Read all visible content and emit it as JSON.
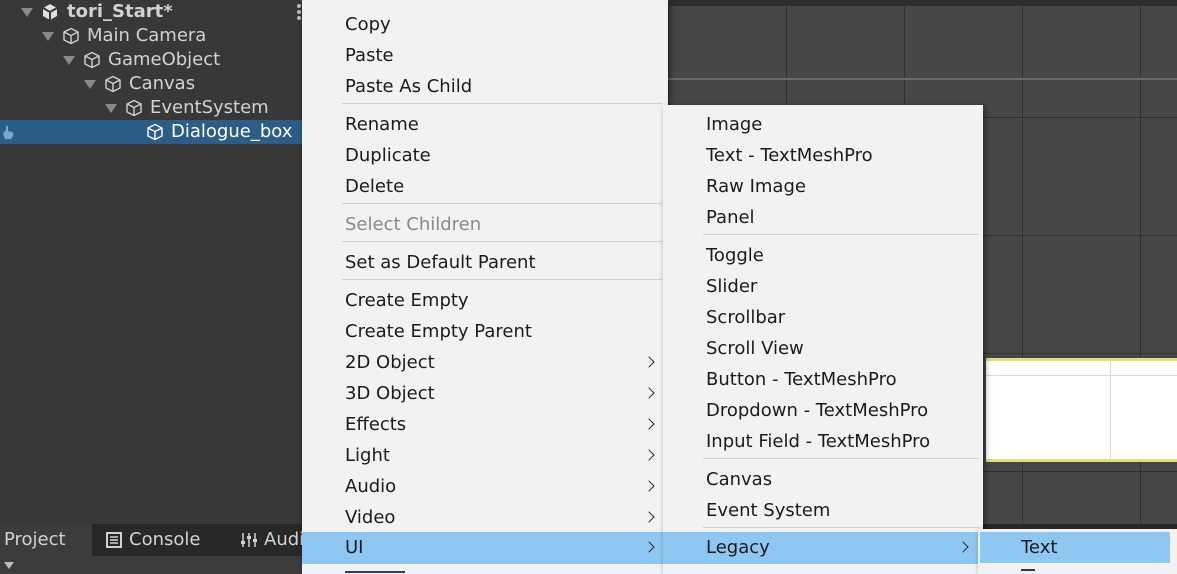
{
  "hierarchy": {
    "items": [
      {
        "label": "tori_Start*",
        "kind": "scene"
      },
      {
        "label": "Main Camera"
      },
      {
        "label": "GameObject"
      },
      {
        "label": "Canvas"
      },
      {
        "label": "EventSystem"
      },
      {
        "label": "Dialogue_box",
        "selected": true
      }
    ]
  },
  "bottom_tabs": [
    {
      "label": "Project",
      "icon": "folder-icon"
    },
    {
      "label": "Console",
      "icon": "console-icon"
    },
    {
      "label": "Audi",
      "icon": "audio-mixer-icon"
    }
  ],
  "context_menu": {
    "items": [
      {
        "label": "Copy"
      },
      {
        "label": "Paste"
      },
      {
        "label": "Paste As Child"
      },
      {
        "label": "Rename"
      },
      {
        "label": "Duplicate"
      },
      {
        "label": "Delete"
      },
      {
        "label": "Select Children",
        "disabled": true
      },
      {
        "label": "Set as Default Parent"
      },
      {
        "label": "Create Empty"
      },
      {
        "label": "Create Empty Parent"
      },
      {
        "label": "2D Object",
        "submenu": true
      },
      {
        "label": "3D Object",
        "submenu": true
      },
      {
        "label": "Effects",
        "submenu": true
      },
      {
        "label": "Light",
        "submenu": true
      },
      {
        "label": "Audio",
        "submenu": true
      },
      {
        "label": "Video",
        "submenu": true
      },
      {
        "label": "UI",
        "submenu": true,
        "highlighted": true
      }
    ]
  },
  "ui_submenu": {
    "items": [
      {
        "label": "Image"
      },
      {
        "label": "Text - TextMeshPro"
      },
      {
        "label": "Raw Image"
      },
      {
        "label": "Panel"
      },
      {
        "label": "Toggle"
      },
      {
        "label": "Slider"
      },
      {
        "label": "Scrollbar"
      },
      {
        "label": "Scroll View"
      },
      {
        "label": "Button - TextMeshPro"
      },
      {
        "label": "Dropdown - TextMeshPro"
      },
      {
        "label": "Input Field - TextMeshPro"
      },
      {
        "label": "Canvas"
      },
      {
        "label": "Event System"
      },
      {
        "label": "Legacy",
        "submenu": true,
        "highlighted": true
      }
    ]
  },
  "legacy_submenu": {
    "items": [
      {
        "label": "Text",
        "highlighted": true
      }
    ]
  },
  "colors": {
    "selection": "#2c5d87",
    "menu_highlight": "#8ec7f2",
    "menu_bg": "#f2f2f2",
    "panel_bg": "#383838"
  }
}
